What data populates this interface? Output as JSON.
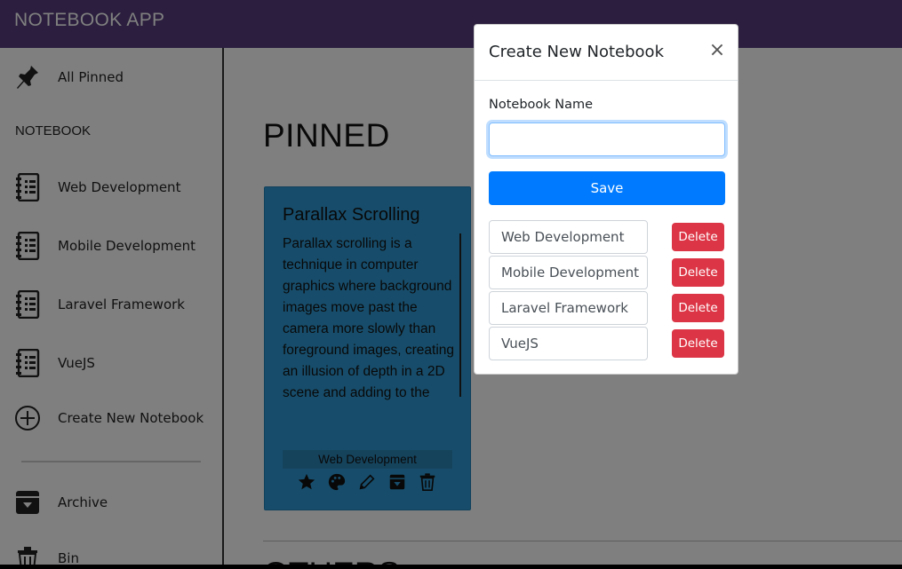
{
  "header": {
    "title": "NOTEBOOK APP",
    "bg": "#563d7c"
  },
  "sidebar": {
    "all_pinned": {
      "label": "All Pinned",
      "icon": "pin-icon"
    },
    "heading": "NOTEBOOK",
    "notebooks": [
      {
        "label": "Web Development",
        "icon": "notebook-icon"
      },
      {
        "label": "Mobile Development",
        "icon": "notebook-icon"
      },
      {
        "label": "Laravel Framework",
        "icon": "notebook-icon"
      },
      {
        "label": "VueJS",
        "icon": "notebook-icon"
      }
    ],
    "create": {
      "label": "Create New Notebook",
      "icon": "plus-circle-icon"
    },
    "archive": {
      "label": "Archive",
      "icon": "archive-icon"
    },
    "bin": {
      "label": "Bin",
      "icon": "trash-icon"
    }
  },
  "main": {
    "pinned_title": "PINNED",
    "others_title": "OTHERS",
    "card": {
      "title": "Parallax Scrolling",
      "body": "Parallax scrolling is a technique in computer graphics where background images move past the camera more slowly than foreground images, creating an illusion of depth in a 2D scene and adding to the",
      "tag": "Web Development",
      "bg": "#2f9bd6",
      "actions": [
        "star-icon",
        "palette-icon",
        "pencil-icon",
        "archive-icon",
        "trash-icon"
      ]
    }
  },
  "modal": {
    "title": "Create New Notebook",
    "close": "×",
    "field_label": "Notebook Name",
    "input_value": "",
    "save_label": "Save",
    "notebooks": [
      {
        "name": "Web Development",
        "delete": "Delete"
      },
      {
        "name": "Mobile Development",
        "delete": "Delete"
      },
      {
        "name": "Laravel Framework",
        "delete": "Delete"
      },
      {
        "name": "VueJS",
        "delete": "Delete"
      }
    ],
    "primary_color": "#007bff",
    "danger_color": "#dc3545"
  }
}
